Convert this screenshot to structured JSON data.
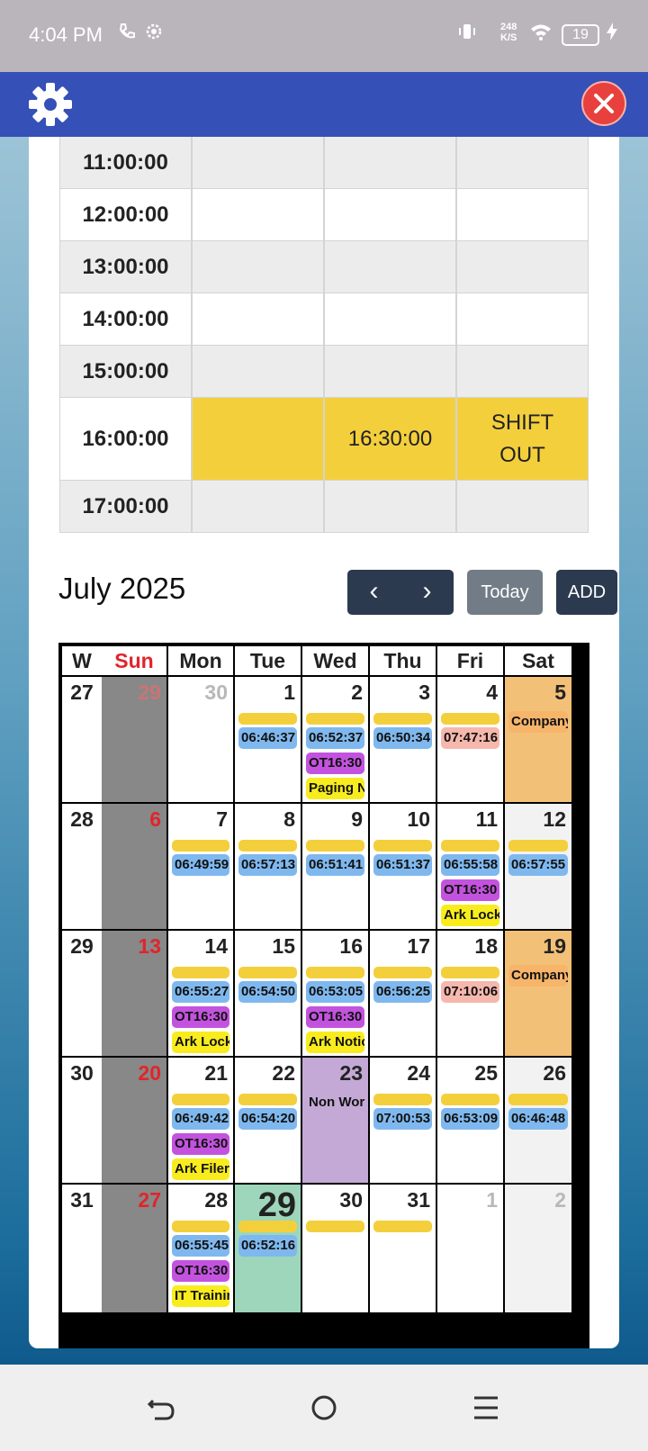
{
  "status_bar": {
    "time": "4:04 PM",
    "net_speed_value": "248",
    "net_speed_unit": "K/S",
    "battery": "19",
    "icons": [
      "call-icon",
      "settings-icon",
      "vibrate-icon",
      "wifi-icon",
      "charging-icon"
    ]
  },
  "header": {
    "settings_icon": "gear-icon",
    "close_icon": "close-icon",
    "colors": {
      "bar": "#3550b6",
      "close": "#e8403c"
    }
  },
  "schedule": {
    "rows": [
      {
        "time": "11:00:00",
        "cells": [
          "",
          "",
          ""
        ],
        "shaded": true
      },
      {
        "time": "12:00:00",
        "cells": [
          "",
          "",
          ""
        ],
        "shaded": false
      },
      {
        "time": "13:00:00",
        "cells": [
          "",
          "",
          ""
        ],
        "shaded": true
      },
      {
        "time": "14:00:00",
        "cells": [
          "",
          "",
          ""
        ],
        "shaded": false
      },
      {
        "time": "15:00:00",
        "cells": [
          "",
          "",
          ""
        ],
        "shaded": true
      },
      {
        "time": "16:00:00",
        "cells": [
          "",
          "16:30:00",
          "SHIFT\nOUT"
        ],
        "shaded": false,
        "highlight": true
      },
      {
        "time": "17:00:00",
        "cells": [
          "",
          "",
          ""
        ],
        "shaded": true
      }
    ]
  },
  "calendar": {
    "month_title": "July 2025",
    "prev_label": "‹",
    "next_label": "›",
    "today_label": "Today",
    "add_label": "ADD",
    "headers": [
      "W",
      "Sun",
      "Mon",
      "Tue",
      "Wed",
      "Thu",
      "Fri",
      "Sat"
    ],
    "weeks": [
      {
        "week": "27",
        "days": [
          {
            "num": "29",
            "type": "sun",
            "numstyle": "fadedred",
            "events": []
          },
          {
            "num": "30",
            "type": "",
            "numstyle": "faded",
            "events": []
          },
          {
            "num": "1",
            "type": "",
            "events": [
              {
                "k": "bar"
              },
              {
                "k": "blue",
                "t": "06:46:37"
              }
            ]
          },
          {
            "num": "2",
            "type": "",
            "events": [
              {
                "k": "bar"
              },
              {
                "k": "blue",
                "t": "06:52:37"
              },
              {
                "k": "purple",
                "t": "OT16:30"
              },
              {
                "k": "yellow",
                "t": "Paging Notification"
              }
            ]
          },
          {
            "num": "3",
            "type": "",
            "events": [
              {
                "k": "bar"
              },
              {
                "k": "blue",
                "t": "06:50:34"
              }
            ]
          },
          {
            "num": "4",
            "type": "",
            "events": [
              {
                "k": "bar"
              },
              {
                "k": "pink",
                "t": "07:47:16"
              }
            ]
          },
          {
            "num": "5",
            "type": "holiday",
            "events": [
              {
                "k": "orange",
                "t": "Company Event"
              }
            ]
          }
        ]
      },
      {
        "week": "28",
        "days": [
          {
            "num": "6",
            "type": "sun",
            "numstyle": "red",
            "events": []
          },
          {
            "num": "7",
            "type": "",
            "events": [
              {
                "k": "bar"
              },
              {
                "k": "blue",
                "t": "06:49:59"
              }
            ]
          },
          {
            "num": "8",
            "type": "",
            "events": [
              {
                "k": "bar"
              },
              {
                "k": "blue",
                "t": "06:57:13"
              }
            ]
          },
          {
            "num": "9",
            "type": "",
            "events": [
              {
                "k": "bar"
              },
              {
                "k": "blue",
                "t": "06:51:41"
              }
            ]
          },
          {
            "num": "10",
            "type": "",
            "events": [
              {
                "k": "bar"
              },
              {
                "k": "blue",
                "t": "06:51:37"
              }
            ]
          },
          {
            "num": "11",
            "type": "",
            "events": [
              {
                "k": "bar"
              },
              {
                "k": "blue",
                "t": "06:55:58"
              },
              {
                "k": "purple",
                "t": "OT16:30"
              },
              {
                "k": "yellow",
                "t": "Ark Lock"
              }
            ]
          },
          {
            "num": "12",
            "type": "sat",
            "events": [
              {
                "k": "bar"
              },
              {
                "k": "blue",
                "t": "06:57:55"
              }
            ]
          }
        ]
      },
      {
        "week": "29",
        "days": [
          {
            "num": "13",
            "type": "sun",
            "numstyle": "red",
            "events": []
          },
          {
            "num": "14",
            "type": "",
            "events": [
              {
                "k": "bar"
              },
              {
                "k": "blue",
                "t": "06:55:27"
              },
              {
                "k": "purple",
                "t": "OT16:30"
              },
              {
                "k": "yellow",
                "t": "Ark Lock"
              }
            ]
          },
          {
            "num": "15",
            "type": "",
            "events": [
              {
                "k": "bar"
              },
              {
                "k": "blue",
                "t": "06:54:50"
              }
            ]
          },
          {
            "num": "16",
            "type": "",
            "events": [
              {
                "k": "bar"
              },
              {
                "k": "blue",
                "t": "06:53:05"
              },
              {
                "k": "purple",
                "t": "OT16:30"
              },
              {
                "k": "yellow",
                "t": "Ark Notice"
              }
            ]
          },
          {
            "num": "17",
            "type": "",
            "events": [
              {
                "k": "bar"
              },
              {
                "k": "blue",
                "t": "06:56:25"
              }
            ]
          },
          {
            "num": "18",
            "type": "",
            "events": [
              {
                "k": "bar"
              },
              {
                "k": "pink",
                "t": "07:10:06"
              }
            ]
          },
          {
            "num": "19",
            "type": "holiday",
            "events": [
              {
                "k": "orange",
                "t": "Company Event"
              }
            ]
          }
        ]
      },
      {
        "week": "30",
        "days": [
          {
            "num": "20",
            "type": "sun",
            "numstyle": "red",
            "events": []
          },
          {
            "num": "21",
            "type": "",
            "events": [
              {
                "k": "bar"
              },
              {
                "k": "blue",
                "t": "06:49:42"
              },
              {
                "k": "purple",
                "t": "OT16:30"
              },
              {
                "k": "yellow",
                "t": "Ark Filer"
              }
            ]
          },
          {
            "num": "22",
            "type": "",
            "events": [
              {
                "k": "bar"
              },
              {
                "k": "blue",
                "t": "06:54:20"
              }
            ]
          },
          {
            "num": "23",
            "type": "nonwork",
            "events": [
              {
                "k": "plain",
                "t": "Non Working"
              }
            ]
          },
          {
            "num": "24",
            "type": "",
            "events": [
              {
                "k": "bar"
              },
              {
                "k": "blue",
                "t": "07:00:53"
              }
            ]
          },
          {
            "num": "25",
            "type": "",
            "events": [
              {
                "k": "bar"
              },
              {
                "k": "blue",
                "t": "06:53:09"
              }
            ]
          },
          {
            "num": "26",
            "type": "sat",
            "events": [
              {
                "k": "bar"
              },
              {
                "k": "blue",
                "t": "06:46:48"
              }
            ]
          }
        ]
      },
      {
        "week": "31",
        "days": [
          {
            "num": "27",
            "type": "sun",
            "numstyle": "red",
            "events": []
          },
          {
            "num": "28",
            "type": "",
            "events": [
              {
                "k": "bar"
              },
              {
                "k": "blue",
                "t": "06:55:45"
              },
              {
                "k": "purple",
                "t": "OT16:30"
              },
              {
                "k": "yellow",
                "t": "IT Training"
              }
            ]
          },
          {
            "num": "29",
            "type": "today",
            "numstyle": "big",
            "events": [
              {
                "k": "bar"
              },
              {
                "k": "blue",
                "t": "06:52:16"
              }
            ]
          },
          {
            "num": "30",
            "type": "",
            "events": [
              {
                "k": "bar"
              }
            ]
          },
          {
            "num": "31",
            "type": "",
            "events": [
              {
                "k": "bar"
              }
            ]
          },
          {
            "num": "1",
            "type": "",
            "numstyle": "faded",
            "events": []
          },
          {
            "num": "2",
            "type": "sat",
            "numstyle": "faded",
            "events": []
          }
        ]
      }
    ]
  },
  "nav_bar": {
    "icons": [
      "back-icon",
      "home-icon",
      "menu-icon"
    ]
  }
}
